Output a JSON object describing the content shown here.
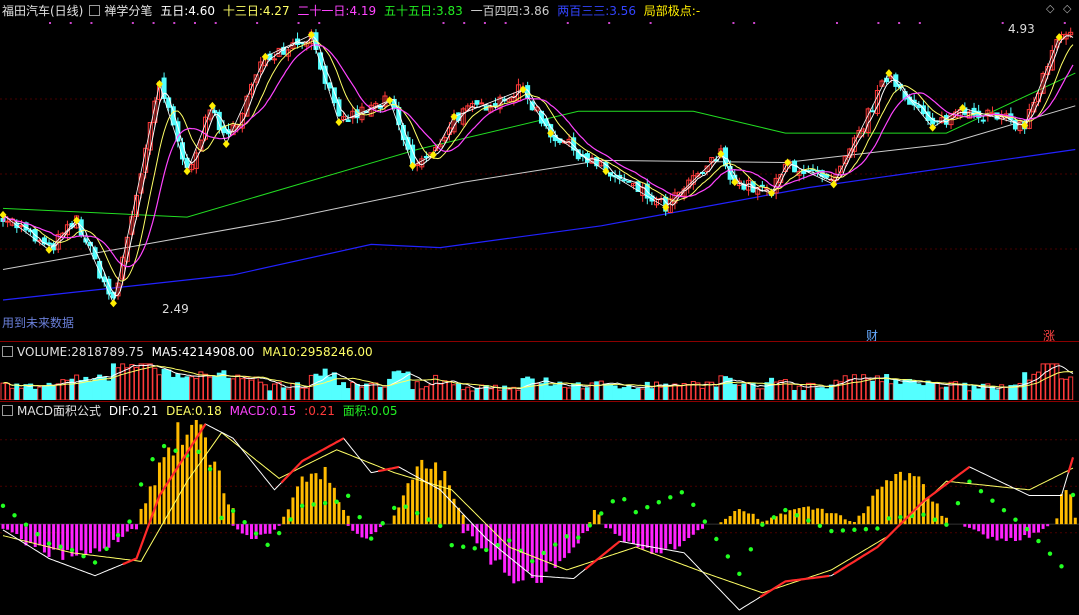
{
  "header": {
    "stock": "福田汽车(日线)",
    "indicator": "禅学分笔",
    "ma5_label": "五日:",
    "ma5_value": "4.60",
    "ma13_label": "十三日:",
    "ma13_value": "4.27",
    "ma21_label": "二十一日:",
    "ma21_value": "4.19",
    "ma55_label": "五十五日:",
    "ma55_value": "3.83",
    "ma144_label": "一百四四:",
    "ma144_value": "3.86",
    "ma233_label": "两百三三:",
    "ma233_value": "3.56",
    "pivot_label": "局部极点:",
    "pivot_value": "-"
  },
  "price_panel": {
    "high_label": "4.93",
    "low_label": "2.49",
    "warning": "用到未来数据",
    "marker_cai": "财",
    "marker_zhang": "涨"
  },
  "volume_panel": {
    "label": "VOLUME:",
    "value": "2818789.75",
    "ma5_label": "MA5:",
    "ma5_value": "4214908.00",
    "ma10_label": "MA10:",
    "ma10_value": "2958246.00"
  },
  "macd_panel": {
    "label": "MACD面积公式",
    "dif_label": "DIF:",
    "dif_value": "0.21",
    "dea_label": "DEA:",
    "dea_value": "0.18",
    "macd_label": "MACD:",
    "macd_value": "0.15",
    "extra_label": ":",
    "extra_value": "0.21",
    "area_label": "面积:",
    "area_value": "0.05"
  },
  "colors": {
    "up": "#ff3a3a",
    "down": "#54ffff",
    "ma5": "#ffffff",
    "ma13": "#ffff66",
    "ma21": "#ff44ff",
    "ma55": "#22dd22",
    "ma144": "#cccccc",
    "ma233": "#2222ff",
    "pivot": "#ffee00",
    "macd_pos": "#ffbb00",
    "macd_neg": "#ff22ff",
    "green_dot": "#22ff22"
  },
  "chart_data": {
    "type": "line",
    "title": "福田汽车(日线)",
    "price_range": [
      2.3,
      5.05
    ],
    "pivots": [
      [
        0,
        3.3
      ],
      [
        20,
        2.98
      ],
      [
        32,
        3.25
      ],
      [
        48,
        2.49
      ],
      [
        68,
        4.5
      ],
      [
        80,
        3.7
      ],
      [
        91,
        4.3
      ],
      [
        97,
        3.95
      ],
      [
        114,
        4.75
      ],
      [
        134,
        4.95
      ],
      [
        146,
        4.15
      ],
      [
        168,
        4.35
      ],
      [
        178,
        3.75
      ],
      [
        187,
        3.85
      ],
      [
        196,
        4.2
      ],
      [
        226,
        4.45
      ],
      [
        238,
        4.05
      ],
      [
        262,
        3.7
      ],
      [
        288,
        3.37
      ],
      [
        312,
        3.86
      ],
      [
        318,
        3.6
      ],
      [
        334,
        3.5
      ],
      [
        341,
        3.78
      ],
      [
        361,
        3.58
      ],
      [
        385,
        4.6
      ],
      [
        404,
        4.1
      ],
      [
        417,
        4.28
      ],
      [
        444,
        4.12
      ],
      [
        459,
        4.93
      ]
    ],
    "x_count": 466,
    "ma55": [
      [
        0,
        3.36
      ],
      [
        80,
        3.28
      ],
      [
        180,
        3.9
      ],
      [
        250,
        4.25
      ],
      [
        300,
        4.25
      ],
      [
        340,
        4.05
      ],
      [
        410,
        4.05
      ],
      [
        466,
        4.6
      ]
    ],
    "ma144": [
      [
        0,
        2.8
      ],
      [
        120,
        3.25
      ],
      [
        200,
        3.6
      ],
      [
        260,
        3.8
      ],
      [
        340,
        3.78
      ],
      [
        410,
        3.95
      ],
      [
        466,
        4.3
      ]
    ],
    "ma233": [
      [
        0,
        2.52
      ],
      [
        100,
        2.75
      ],
      [
        160,
        3.03
      ],
      [
        190,
        3.0
      ],
      [
        260,
        3.2
      ],
      [
        350,
        3.55
      ],
      [
        466,
        3.9
      ]
    ],
    "volume_axis_max": 5000000,
    "macd_axis": [
      -0.3,
      0.35
    ],
    "dif": [
      [
        0,
        -0.02
      ],
      [
        20,
        -0.12
      ],
      [
        40,
        -0.18
      ],
      [
        58,
        -0.12
      ],
      [
        68,
        0.1
      ],
      [
        88,
        0.35
      ],
      [
        100,
        0.3
      ],
      [
        118,
        0.12
      ],
      [
        130,
        0.22
      ],
      [
        148,
        0.3
      ],
      [
        160,
        0.18
      ],
      [
        172,
        0.2
      ],
      [
        190,
        0.12
      ],
      [
        210,
        -0.05
      ],
      [
        230,
        -0.18
      ],
      [
        248,
        -0.19
      ],
      [
        268,
        -0.06
      ],
      [
        296,
        -0.1
      ],
      [
        320,
        -0.3
      ],
      [
        340,
        -0.2
      ],
      [
        360,
        -0.18
      ],
      [
        380,
        -0.08
      ],
      [
        400,
        0.08
      ],
      [
        420,
        0.2
      ],
      [
        446,
        0.1
      ],
      [
        460,
        0.1
      ],
      [
        466,
        0.26
      ]
    ],
    "dea": [
      [
        0,
        -0.04
      ],
      [
        30,
        -0.1
      ],
      [
        60,
        -0.13
      ],
      [
        80,
        0.15
      ],
      [
        95,
        0.32
      ],
      [
        120,
        0.16
      ],
      [
        145,
        0.26
      ],
      [
        170,
        0.18
      ],
      [
        195,
        0.12
      ],
      [
        220,
        -0.08
      ],
      [
        245,
        -0.16
      ],
      [
        275,
        -0.08
      ],
      [
        305,
        -0.17
      ],
      [
        330,
        -0.24
      ],
      [
        360,
        -0.16
      ],
      [
        385,
        -0.04
      ],
      [
        410,
        0.15
      ],
      [
        446,
        0.12
      ],
      [
        466,
        0.2
      ]
    ],
    "macd_hist": [
      {
        "from": 0,
        "to": 58,
        "sign": -1,
        "peak": 0.12
      },
      {
        "from": 60,
        "to": 100,
        "sign": 1,
        "peak": 0.35
      },
      {
        "from": 100,
        "to": 120,
        "sign": -1,
        "peak": 0.05
      },
      {
        "from": 122,
        "to": 150,
        "sign": 1,
        "peak": 0.2
      },
      {
        "from": 150,
        "to": 165,
        "sign": -1,
        "peak": 0.05
      },
      {
        "from": 170,
        "to": 200,
        "sign": 1,
        "peak": 0.22
      },
      {
        "from": 200,
        "to": 255,
        "sign": -1,
        "peak": 0.2
      },
      {
        "from": 255,
        "to": 260,
        "sign": 1,
        "peak": 0.06
      },
      {
        "from": 262,
        "to": 305,
        "sign": -1,
        "peak": 0.1
      },
      {
        "from": 312,
        "to": 330,
        "sign": 1,
        "peak": 0.05
      },
      {
        "from": 330,
        "to": 370,
        "sign": 1,
        "peak": 0.06
      },
      {
        "from": 372,
        "to": 410,
        "sign": 1,
        "peak": 0.18
      },
      {
        "from": 418,
        "to": 455,
        "sign": -1,
        "peak": 0.06
      },
      {
        "from": 458,
        "to": 466,
        "sign": 1,
        "peak": 0.15
      }
    ]
  }
}
